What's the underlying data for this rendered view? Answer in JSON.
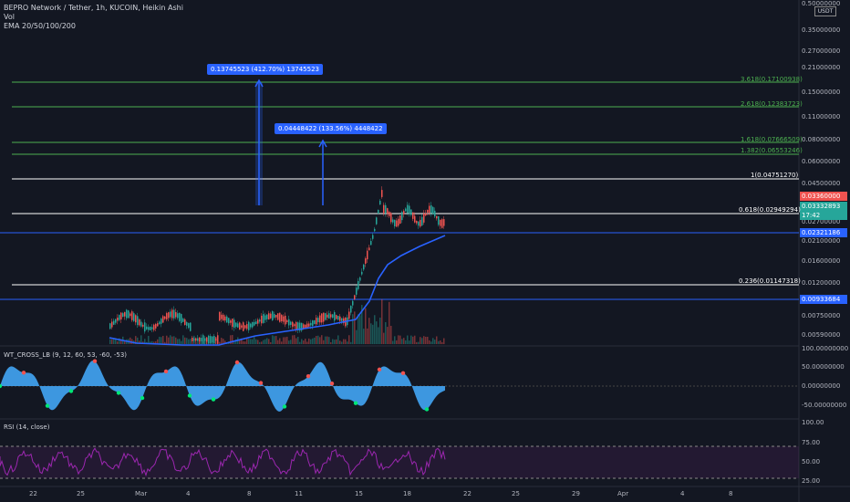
{
  "header": {
    "title": "BEPRO Network / Tether, 1h, KUCOIN, Heikin Ashi",
    "vol": "Vol",
    "ema": "EMA 20/50/100/200"
  },
  "currency_button": "USDT",
  "price_axis": [
    "0.50000000",
    "0.35000000",
    "0.27000000",
    "0.21000000",
    "0.15000000",
    "0.11000000",
    "0.08000000",
    "0.06000000",
    "0.04500000",
    "0.02700000",
    "0.02100000",
    "0.01600000",
    "0.01200000",
    "0.00750000",
    "0.00590000"
  ],
  "price_tags": {
    "current_red": "0.03360000",
    "current_green": "0.03332893",
    "countdown": "17:42",
    "line_upper": "0.02321186",
    "line_lower": "0.00933684"
  },
  "fib_levels": [
    {
      "label": "3.618(0.17100938)",
      "color": "#4caf50"
    },
    {
      "label": "2.618(0.12383723)",
      "color": "#4caf50"
    },
    {
      "label": "1.618(0.07666509)",
      "color": "#4caf50"
    },
    {
      "label": "1.382(0.06553246)",
      "color": "#4caf50"
    },
    {
      "label": "1(0.04751270)",
      "color": "#ffffff"
    },
    {
      "label": "0.618(0.02949294)",
      "color": "#ffffff"
    },
    {
      "label": "0.236(0.01147318)",
      "color": "#ffffff"
    }
  ],
  "measures": [
    {
      "label": "0.13745523 (412.70%) 13745523"
    },
    {
      "label": "0.04448422 (133.56%) 4448422"
    }
  ],
  "wt": {
    "title": "WT_CROSS_LB (9, 12, 60, 53, -60, -53)",
    "axis": [
      "100.00000000",
      "50.00000000",
      "0.00000000",
      "-50.00000000"
    ]
  },
  "rsi": {
    "title": "RSI (14, close)",
    "axis": [
      "100.00",
      "75.00",
      "50.00",
      "25.00"
    ]
  },
  "date_axis": [
    "22",
    "25",
    "Mar",
    "4",
    "8",
    "11",
    "15",
    "18",
    "22",
    "25",
    "29",
    "Apr",
    "4",
    "8"
  ],
  "colors": {
    "bg": "#131722",
    "up": "#26a69a",
    "down": "#ef5350",
    "ema": "#2962ff",
    "fib": "#4caf50",
    "rsi": "#9c27b0"
  }
}
